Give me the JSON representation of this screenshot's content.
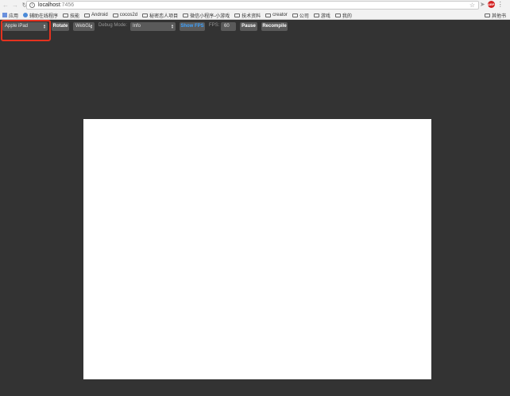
{
  "browser": {
    "url_host": "localhost",
    "url_port": ":7456"
  },
  "bookmarks": [
    {
      "label": "应用",
      "icon": "apps-grid-icon"
    },
    {
      "label": "辅助在线程序",
      "icon": "globe-icon"
    },
    {
      "label": "技能",
      "icon": "folder-icon"
    },
    {
      "label": "Android",
      "icon": "folder-icon"
    },
    {
      "label": "cocos2d",
      "icon": "folder-icon"
    },
    {
      "label": "秘密恋人项目",
      "icon": "folder-icon"
    },
    {
      "label": "微信小程序-小游戏",
      "icon": "folder-icon"
    },
    {
      "label": "技术资料",
      "icon": "folder-icon"
    },
    {
      "label": "creator",
      "icon": "folder-icon"
    },
    {
      "label": "公司",
      "icon": "folder-icon"
    },
    {
      "label": "游戏",
      "icon": "folder-icon"
    },
    {
      "label": "我的",
      "icon": "folder-icon"
    }
  ],
  "bookmarks_other": "其他书",
  "toolbar": {
    "device_select": "Apple iPad",
    "rotate_label": "Rotate",
    "renderer_select": "WebGL",
    "debug_mode_label": "Debug Mode:",
    "debug_mode_select": "Info",
    "show_fps_label": "Show FPS",
    "fps_label": "FPS:",
    "fps_value": "60",
    "pause_label": "Pause",
    "recompile_label": "Recompile"
  },
  "colors": {
    "highlight": "#e5321f",
    "page_background": "#333333",
    "show_fps_text": "#3fa3ff"
  }
}
